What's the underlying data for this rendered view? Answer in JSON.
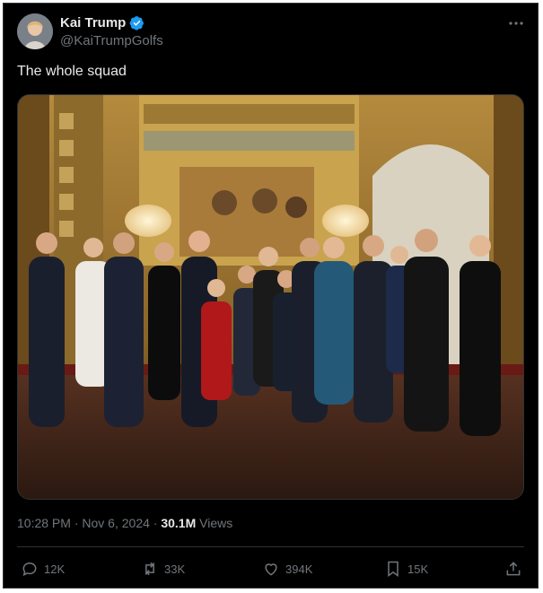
{
  "author": {
    "name": "Kai Trump",
    "handle": "@KaiTrumpGolfs",
    "verified": true
  },
  "tweet": {
    "text": "The whole squad"
  },
  "meta": {
    "time": "10:28 PM",
    "date": "Nov 6, 2024",
    "views_count": "30.1M",
    "views_label": "Views"
  },
  "actions": {
    "replies": "12K",
    "reposts": "33K",
    "likes": "394K",
    "bookmarks": "15K"
  },
  "colors": {
    "background": "#000000",
    "text_primary": "#e7e9ea",
    "text_secondary": "#71767b",
    "verified_blue": "#1d9bf0",
    "border": "#2f3336"
  },
  "icons": [
    "verified-badge-icon",
    "more-icon",
    "reply-icon",
    "repost-icon",
    "like-icon",
    "bookmark-icon",
    "share-icon"
  ]
}
